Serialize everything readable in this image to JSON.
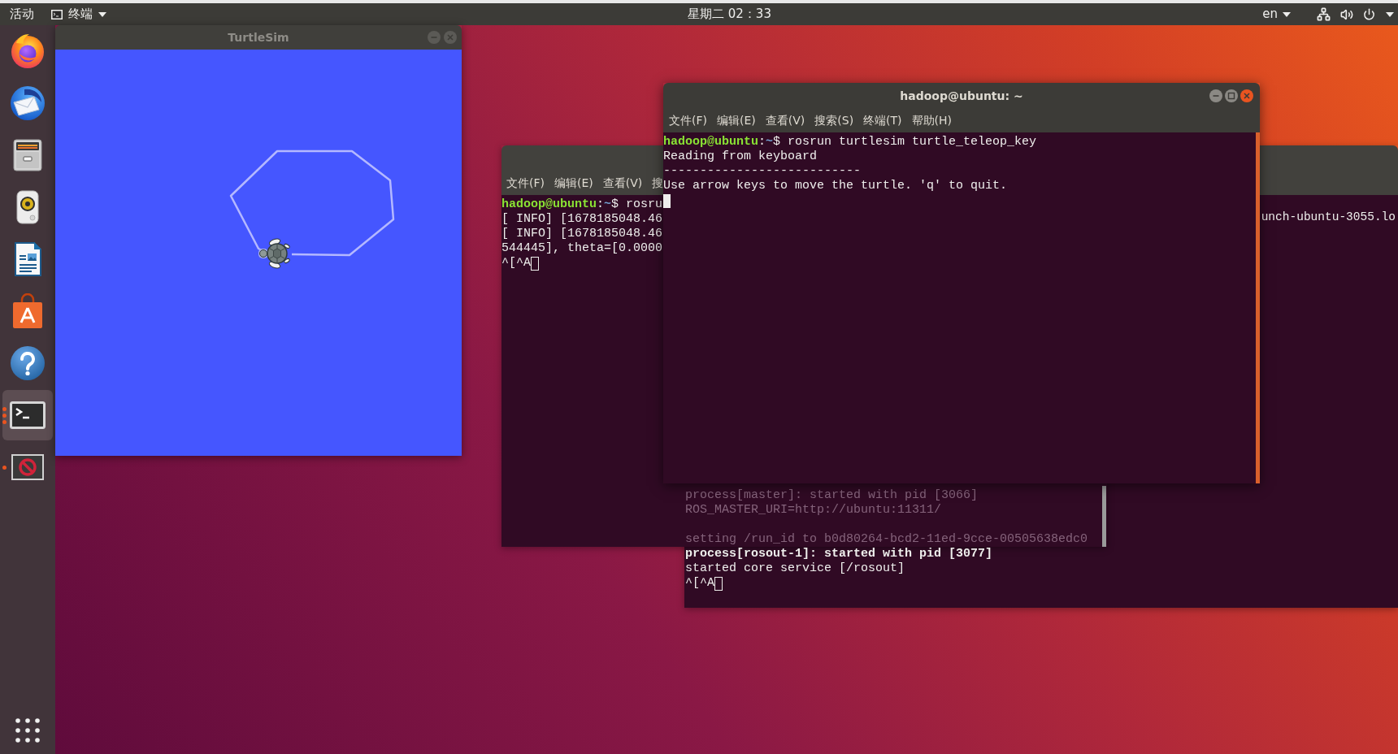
{
  "top_bar": {
    "activities": "活动",
    "app_menu": "终端",
    "clock": "星期二 02：33",
    "keyboard_layout": "en"
  },
  "dock": {
    "items": [
      {
        "kind": "browser",
        "selected": false,
        "running": false,
        "multiple_windows": false
      },
      {
        "kind": "mail",
        "selected": false,
        "running": false,
        "multiple_windows": false
      },
      {
        "kind": "files",
        "selected": false,
        "running": false,
        "multiple_windows": false
      },
      {
        "kind": "music",
        "selected": false,
        "running": false,
        "multiple_windows": false
      },
      {
        "kind": "document",
        "selected": false,
        "running": false,
        "multiple_windows": false
      },
      {
        "kind": "store",
        "selected": false,
        "running": false,
        "multiple_windows": false
      },
      {
        "kind": "help",
        "selected": false,
        "running": false,
        "multiple_windows": false
      },
      {
        "kind": "terminal",
        "selected": true,
        "running": true,
        "multiple_windows": true
      },
      {
        "kind": "blocked",
        "selected": false,
        "running": true,
        "multiple_windows": false
      }
    ]
  },
  "turtlesim": {
    "title": "TurtleSim",
    "focused": false
  },
  "terminals": [
    {
      "title": "hadoop@ubuntu: ~",
      "focused": true,
      "menu": [
        "文件(F)",
        "编辑(E)",
        "查看(V)",
        "搜索(S)",
        "终端(T)",
        "帮助(H)"
      ],
      "lines": [
        {
          "segments": [
            {
              "kind": "user",
              "text": "hadoop@ubuntu"
            },
            {
              "kind": "plain",
              "text": ":"
            },
            {
              "kind": "dir",
              "text": "~"
            },
            {
              "kind": "plain",
              "text": "$ rosrun turtlesim turtle_teleop_key"
            }
          ]
        },
        {
          "text": "Reading from keyboard"
        },
        {
          "text": "---------------------------"
        },
        {
          "text": "Use arrow keys to move the turtle. 'q' to quit."
        },
        {
          "cursor": true
        }
      ]
    },
    {
      "focused": false,
      "menu": [
        "文件(F)",
        "编辑(E)",
        "查看(V)",
        "搜"
      ],
      "lines": [
        {
          "segments": [
            {
              "kind": "user",
              "text": "hadoop@ubuntu"
            },
            {
              "kind": "plain",
              "text": ":"
            },
            {
              "kind": "dir",
              "text": "~"
            },
            {
              "kind": "plain",
              "text": "$ rosru"
            }
          ]
        },
        {
          "text": "[ INFO] [1678185048.46"
        },
        {
          "text": "[ INFO] [1678185048.46"
        },
        {
          "text": "544445], theta=[0.0000"
        },
        {
          "text": "^[^A",
          "cursor": true
        }
      ]
    },
    {
      "focused": false,
      "partial_line": "unch-ubuntu-3055.lo",
      "lines": [
        {
          "text": "process[master]: started with pid [3066]",
          "bold": false,
          "faded": true
        },
        {
          "text": "ROS_MASTER_URI=http://ubuntu:11311/",
          "bold": false,
          "faded": true
        },
        {
          "kind": "blank"
        },
        {
          "text": "setting /run_id to b0d80264-bcd2-11ed-9cce-00505638edc0",
          "bold": false,
          "faded": true
        },
        {
          "text": "process[rosout-1]: started with pid [3077]",
          "bold": true,
          "faded": false
        },
        {
          "text": "started core service [/rosout]",
          "bold": false,
          "faded": false
        },
        {
          "text": "^[^A",
          "cursor": true,
          "bold": false,
          "faded": false
        }
      ]
    }
  ]
}
